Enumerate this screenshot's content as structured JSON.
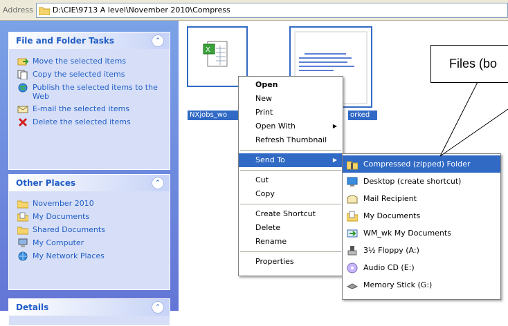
{
  "address": {
    "label": "Address",
    "path": "D:\\CIE\\9713 A level\\November 2010\\Compress"
  },
  "task_pane": {
    "file_tasks": {
      "title": "File and Folder Tasks",
      "items": [
        "Move the selected items",
        "Copy the selected items",
        "Publish the selected items to the Web",
        "E-mail the selected items",
        "Delete the selected items"
      ]
    },
    "other_places": {
      "title": "Other Places",
      "items": [
        "November 2010",
        "My Documents",
        "Shared Documents",
        "My Computer",
        "My Network Places"
      ]
    },
    "details": {
      "title": "Details"
    }
  },
  "files": [
    {
      "caption": "NXjobs_wo"
    },
    {
      "caption": "orked"
    }
  ],
  "context_menu": {
    "items": [
      "Open",
      "New",
      "Print",
      "Open With",
      "Refresh Thumbnail",
      "Send To",
      "Cut",
      "Copy",
      "Create Shortcut",
      "Delete",
      "Rename",
      "Properties"
    ]
  },
  "send_to": {
    "items": [
      "Compressed (zipped) Folder",
      "Desktop (create shortcut)",
      "Mail Recipient",
      "My Documents",
      "WM_wk My Documents",
      "3½ Floppy (A:)",
      "Audio CD (E:)",
      "Memory Stick (G:)"
    ]
  },
  "callout": {
    "text": "Files (bo"
  },
  "colors": {
    "highlight": "#316ac5",
    "task_link": "#215dc6",
    "pane_bg": "#6375d6"
  }
}
